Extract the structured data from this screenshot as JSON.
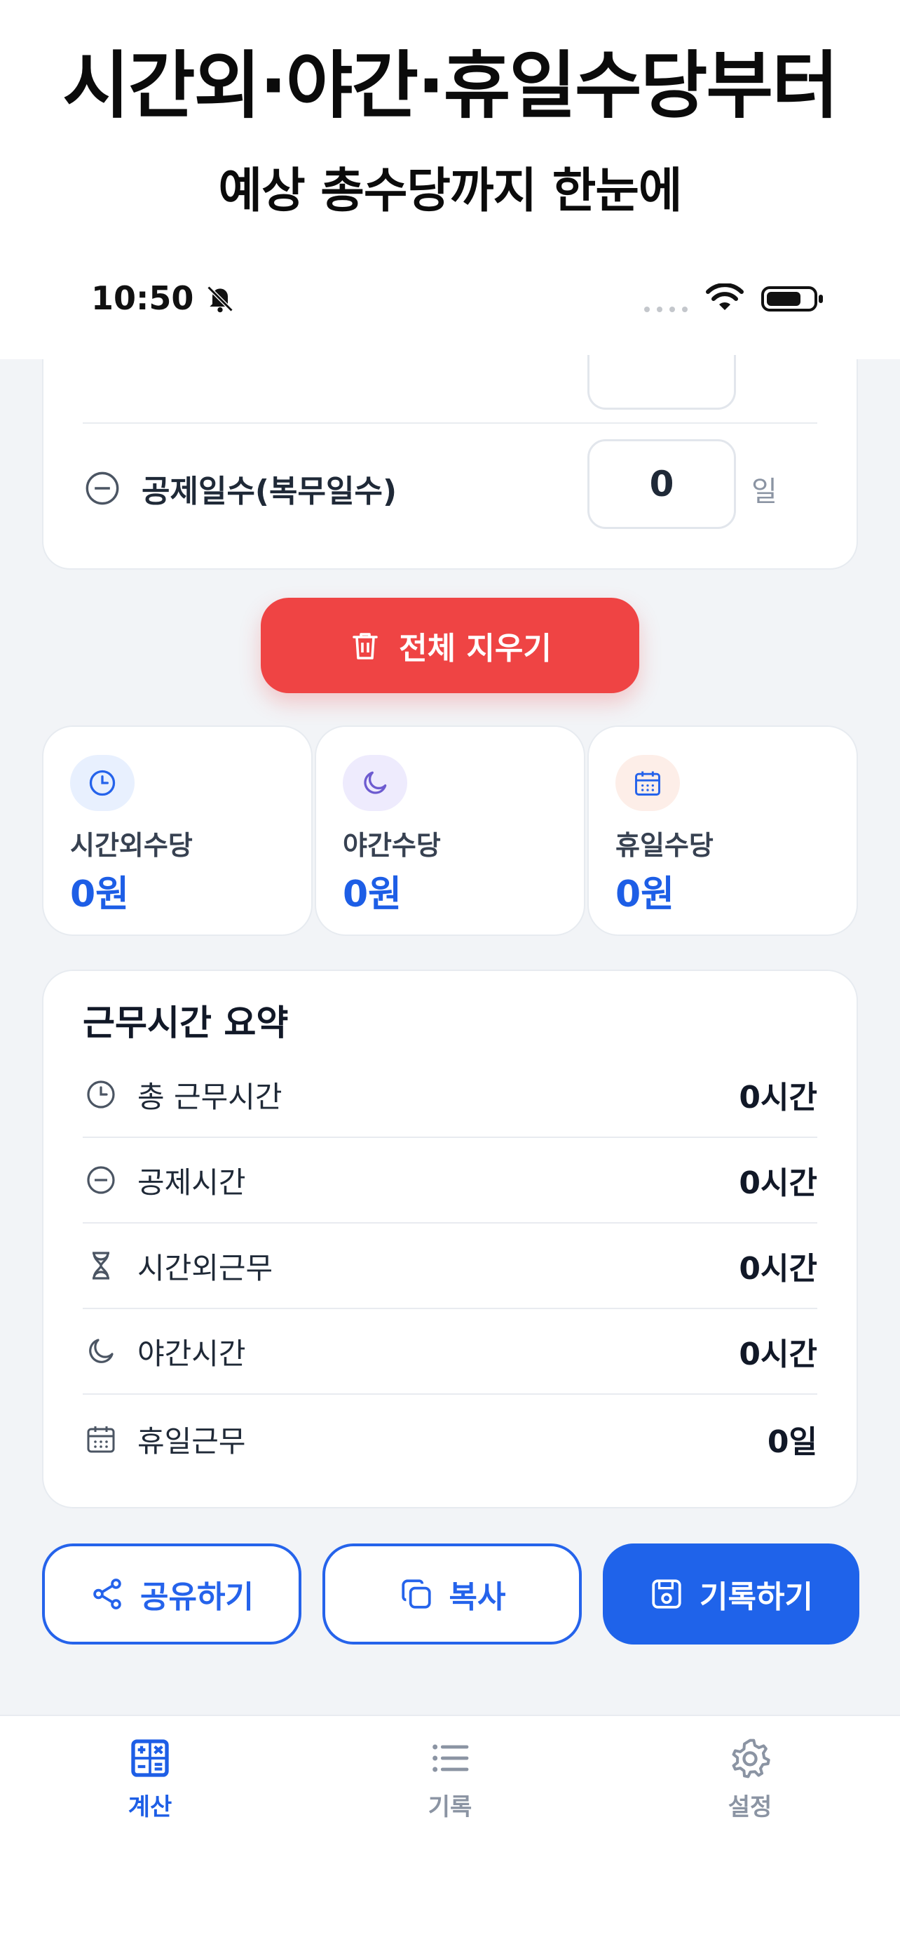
{
  "promo": {
    "title": "시간외·야간·휴일수당부터",
    "subtitle": "예상 총수당까지 한눈에"
  },
  "status_bar": {
    "time": "10:50"
  },
  "deduction": {
    "label": "공제일수(복무일수)",
    "value": "0",
    "unit": "일"
  },
  "clear_button": {
    "label": "전체 지우기"
  },
  "stats": [
    {
      "label": "시간외수당",
      "value": "0원",
      "icon": "clock-icon"
    },
    {
      "label": "야간수당",
      "value": "0원",
      "icon": "moon-icon"
    },
    {
      "label": "휴일수당",
      "value": "0원",
      "icon": "calendar-icon"
    }
  ],
  "summary": {
    "title": "근무시간 요약",
    "rows": [
      {
        "label": "총 근무시간",
        "value": "0시간",
        "icon": "clock-icon"
      },
      {
        "label": "공제시간",
        "value": "0시간",
        "icon": "minus-circle-icon"
      },
      {
        "label": "시간외근무",
        "value": "0시간",
        "icon": "hourglass-icon"
      },
      {
        "label": "야간시간",
        "value": "0시간",
        "icon": "moon-icon"
      },
      {
        "label": "휴일근무",
        "value": "0일",
        "icon": "calendar-icon"
      }
    ]
  },
  "actions": {
    "share": "공유하기",
    "copy": "복사",
    "save": "기록하기"
  },
  "tabs": {
    "calc": "계산",
    "records": "기록",
    "settings": "설정"
  },
  "colors": {
    "accent": "#1f63ea",
    "danger": "#ef4444",
    "background": "#f2f4f7"
  }
}
